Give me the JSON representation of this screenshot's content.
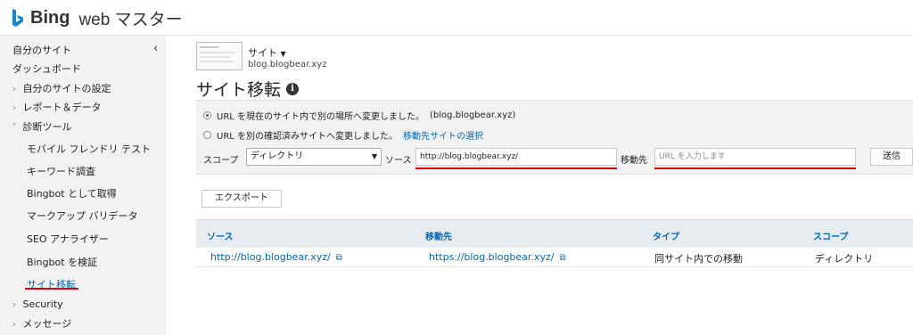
{
  "header": {
    "brand": "Bing",
    "product": "web マスター"
  },
  "sidebar": {
    "items": [
      {
        "label": "自分のサイト"
      },
      {
        "label": "ダッシュボード"
      },
      {
        "label": "自分のサイトの設定"
      },
      {
        "label": "レポート＆データ"
      },
      {
        "label": "診断ツール"
      },
      {
        "label": "モバイル フレンドリ テスト"
      },
      {
        "label": "キーワード調査"
      },
      {
        "label": "Bingbot として取得"
      },
      {
        "label": "マークアップ バリデータ"
      },
      {
        "label": "SEO アナライザー"
      },
      {
        "label": "Bingbot を検証"
      },
      {
        "label": "サイト移転"
      },
      {
        "label": "Security"
      },
      {
        "label": "メッセージ"
      }
    ]
  },
  "site": {
    "selector_label": "サイト",
    "url": "blog.blogbear.xyz"
  },
  "page": {
    "title": "サイト移転"
  },
  "form": {
    "option1": "URL を現在のサイト内で別の場所へ変更しました。",
    "option1_site": "(blog.blogbear.xyz)",
    "option2": "URL を別の確認済みサイトへ変更しました。",
    "option2_link": "移動先サイトの選択",
    "scope_label": "スコープ",
    "scope_value": "ディレクトリ",
    "source_label": "ソース",
    "source_value": "http://blog.blogbear.xyz/",
    "dest_label": "移動先",
    "dest_placeholder": "URL を入力します",
    "send_label": "送信"
  },
  "export_label": "エクスポート",
  "table": {
    "headers": [
      "ソース",
      "移動先",
      "タイプ",
      "スコープ"
    ],
    "rows": [
      [
        "http://blog.blogbear.xyz/",
        "https://blog.blogbear.xyz/",
        "同サイト内での移動",
        "ディレクトリ"
      ]
    ]
  },
  "colors": {
    "accent": "#0067b8",
    "highlight": "#e0000b",
    "sidebar_bg": "#f2f2f2",
    "table_head_bg": "#e7ecf1"
  }
}
